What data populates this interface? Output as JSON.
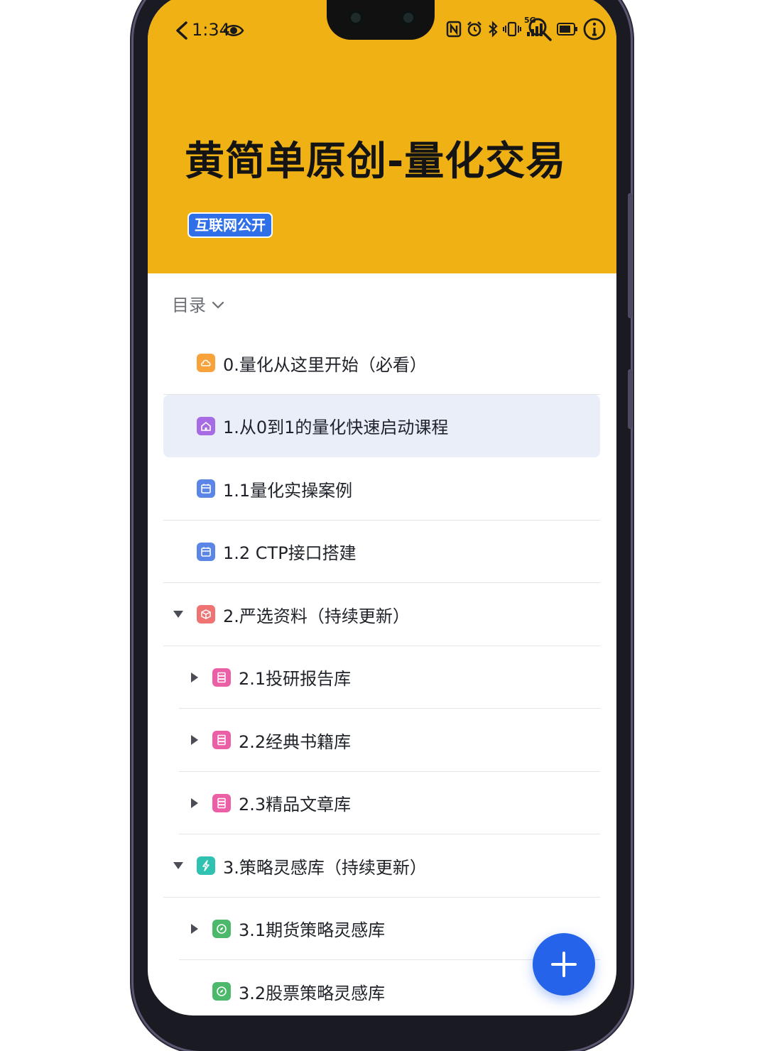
{
  "status_bar": {
    "time": "1:34",
    "network_label": "5G"
  },
  "header": {
    "title": "黄简单原创-量化交易",
    "badge": "互联网公开",
    "background_color": "#f0b114",
    "badge_color": "#2f6fe8"
  },
  "toc": {
    "label": "目录",
    "items": [
      {
        "label": "0.量化从这里开始（必看）",
        "icon": "cloud-icon",
        "icon_color": "#f7a23b",
        "depth": 0,
        "expander": "none",
        "selected": false
      },
      {
        "label": "1.从0到1的量化快速启动课程",
        "icon": "home-icon",
        "icon_color": "#a86be6",
        "depth": 0,
        "expander": "none",
        "selected": true
      },
      {
        "label": "1.1量化实操案例",
        "icon": "calendar-icon",
        "icon_color": "#5b86e8",
        "depth": 0,
        "expander": "none",
        "selected": false
      },
      {
        "label": "1.2 CTP接口搭建",
        "icon": "calendar-icon",
        "icon_color": "#5b86e8",
        "depth": 0,
        "expander": "none",
        "selected": false
      },
      {
        "label": "2.严选资料（持续更新）",
        "icon": "box-icon",
        "icon_color": "#f07373",
        "depth": 0,
        "expander": "expanded",
        "selected": false
      },
      {
        "label": "2.1投研报告库",
        "icon": "database-icon",
        "icon_color": "#ea5fa6",
        "depth": 1,
        "expander": "collapsed",
        "selected": false
      },
      {
        "label": "2.2经典书籍库",
        "icon": "database-icon",
        "icon_color": "#ea5fa6",
        "depth": 1,
        "expander": "collapsed",
        "selected": false
      },
      {
        "label": "2.3精品文章库",
        "icon": "database-icon",
        "icon_color": "#ea5fa6",
        "depth": 1,
        "expander": "collapsed",
        "selected": false
      },
      {
        "label": "3.策略灵感库（持续更新）",
        "icon": "lightning-icon",
        "icon_color": "#2fc2b0",
        "depth": 0,
        "expander": "expanded",
        "selected": false
      },
      {
        "label": "3.1期货策略灵感库",
        "icon": "compass-icon",
        "icon_color": "#4cb86a",
        "depth": 1,
        "expander": "collapsed",
        "selected": false
      },
      {
        "label": "3.2股票策略灵感库",
        "icon": "compass-icon",
        "icon_color": "#4cb86a",
        "depth": 1,
        "expander": "none",
        "selected": false
      }
    ]
  },
  "fab": {
    "icon": "plus-icon",
    "color": "#2563eb"
  }
}
